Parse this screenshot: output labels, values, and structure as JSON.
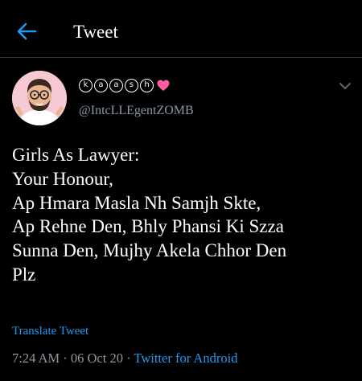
{
  "header": {
    "title": "Tweet",
    "back_icon": "arrow-left-icon"
  },
  "tweet": {
    "display_name_letters": [
      "k",
      "a",
      "a",
      "s",
      "h"
    ],
    "display_name_emoji": "pink-heart-icon",
    "handle": "@IntcLLEgentZOMB",
    "text_lines": [
      "Girls As Lawyer:",
      "Your Honour,",
      "Ap Hmara Masla Nh Samjh Skte,",
      "Ap Rehne Den, Bhly Phansi Ki Szza",
      "Sunna Den, Mujhy Akela Chhor Den",
      "Plz"
    ],
    "translate_label": "Translate Tweet",
    "time": "7:24 AM",
    "separator": "·",
    "date": "06 Oct 20",
    "source": "Twitter for Android"
  },
  "colors": {
    "background": "#000000",
    "accent": "#1d9bf0",
    "secondary_text": "#8b98a5",
    "heart": "#ff5fa2",
    "divider": "#2f3336"
  }
}
